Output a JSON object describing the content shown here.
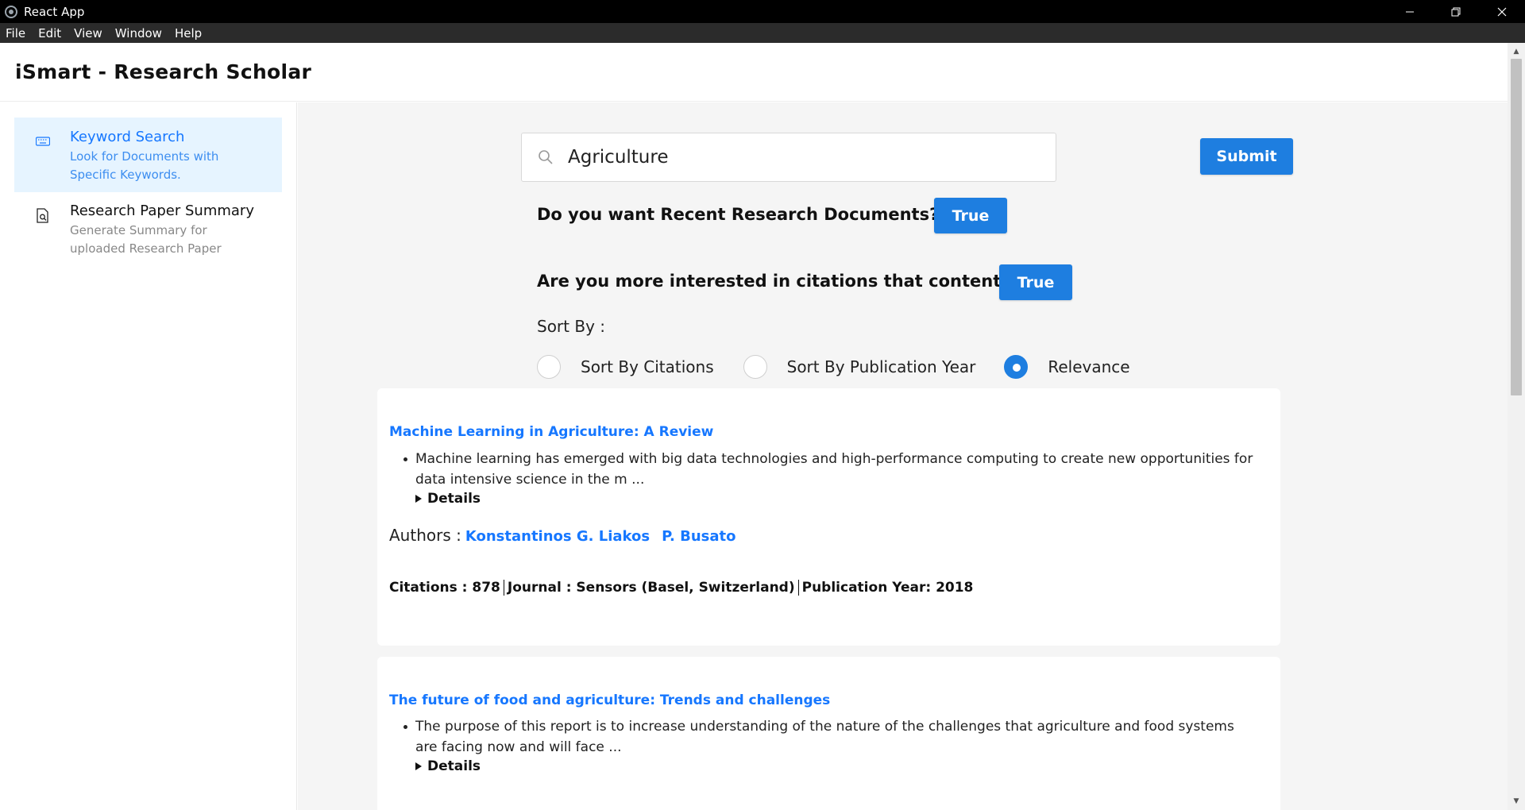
{
  "window": {
    "title": "React App",
    "controls": [
      "minimize-icon",
      "restore-icon",
      "close-icon"
    ]
  },
  "menu": [
    "File",
    "Edit",
    "View",
    "Window",
    "Help"
  ],
  "app": {
    "title": "iSmart - Research Scholar"
  },
  "sidebar": {
    "items": [
      {
        "title": "Keyword Search",
        "desc_line1": "Look for Documents with",
        "desc_line2": "Specific Keywords.",
        "icon": "keyboard-icon",
        "active": true
      },
      {
        "title": "Research Paper Summary",
        "desc_line1": "Generate Summary for",
        "desc_line2": "uploaded Research Paper",
        "icon": "file-search-icon",
        "active": false
      }
    ]
  },
  "search": {
    "value": "Agriculture",
    "placeholder": "",
    "submit_label": "Submit"
  },
  "questions": {
    "recent_label": "Do you want Recent Research Documents?",
    "recent_value": "True",
    "citations_label": "Are you more interested in citations that content?",
    "citations_value": "True"
  },
  "sort": {
    "label": "Sort By :",
    "options": [
      "Sort By Citations",
      "Sort By Publication Year",
      "Relevance"
    ],
    "selected": "Relevance"
  },
  "results": [
    {
      "title": "Machine Learning in Agriculture: A Review",
      "abstract_line1": "Machine learning has emerged with big data technologies and high-performance computing to create new opportunities for",
      "abstract_line2": "data intensive science in the m ...",
      "details_label": "Details",
      "authors_label": "Authors :",
      "authors": [
        "Konstantinos G. Liakos",
        "P. Busato"
      ],
      "citations": "Citations : 878",
      "journal": "Journal : Sensors (Basel, Switzerland)",
      "year": "Publication Year: 2018"
    },
    {
      "title": "The future of food and agriculture: Trends and challenges",
      "abstract_line1": "The purpose of this report is to increase understanding of the nature of the challenges that agriculture and food systems",
      "abstract_line2": "are facing now and will face ...",
      "details_label": "Details"
    }
  ],
  "colors": {
    "accent": "#1e7ee0",
    "link": "#1677ff",
    "active_bg": "#e6f4ff",
    "main_bg": "#f5f5f5"
  }
}
